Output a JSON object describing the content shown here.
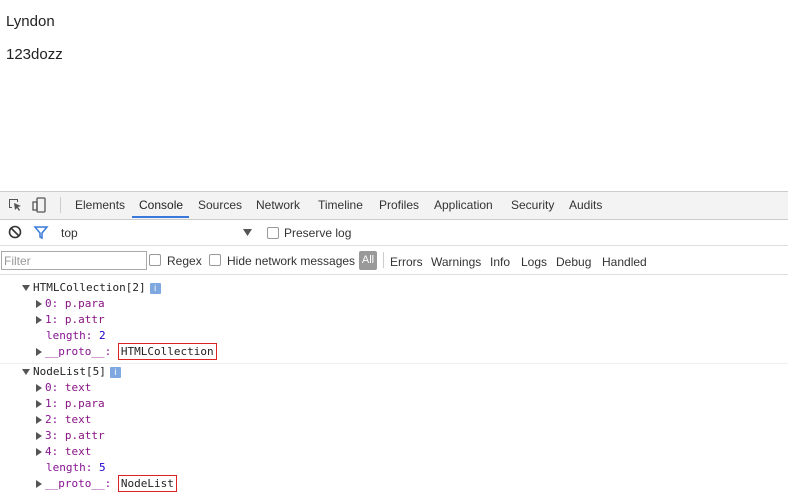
{
  "page": {
    "line1": "Lyndon",
    "line2": "123dozz"
  },
  "devtools": {
    "tabs": [
      "Elements",
      "Console",
      "Sources",
      "Network",
      "Timeline",
      "Profiles",
      "Application",
      "Security",
      "Audits"
    ],
    "active_tab": "Console",
    "context": "top",
    "preserve_log_label": "Preserve log",
    "filter_placeholder": "Filter",
    "regex_label": "Regex",
    "hide_network_label": "Hide network messages",
    "all_label": "All",
    "levels": [
      "Errors",
      "Warnings",
      "Info",
      "Logs",
      "Debug",
      "Handled"
    ]
  },
  "console": {
    "group1": {
      "header": "HTMLCollection[2]",
      "items": [
        {
          "key": "0",
          "value": "p.para"
        },
        {
          "key": "1",
          "value": "p.attr"
        }
      ],
      "length_key": "length",
      "length_value": "2",
      "proto_key": "__proto__",
      "proto_value": "HTMLCollection"
    },
    "group2": {
      "header": "NodeList[5]",
      "items": [
        {
          "key": "0",
          "value": "text"
        },
        {
          "key": "1",
          "value": "p.para"
        },
        {
          "key": "2",
          "value": "text"
        },
        {
          "key": "3",
          "value": "p.attr"
        },
        {
          "key": "4",
          "value": "text"
        }
      ],
      "length_key": "length",
      "length_value": "5",
      "proto_key": "__proto__",
      "proto_value": "NodeList"
    }
  },
  "colors": {
    "accent": "#3879d9",
    "highlight_box": "#dd2222",
    "property_key": "#881391"
  },
  "icons": {
    "inspect": "inspect-element-icon",
    "device": "device-toolbar-icon",
    "clear": "clear-console-icon",
    "filter": "filter-funnel-icon"
  }
}
